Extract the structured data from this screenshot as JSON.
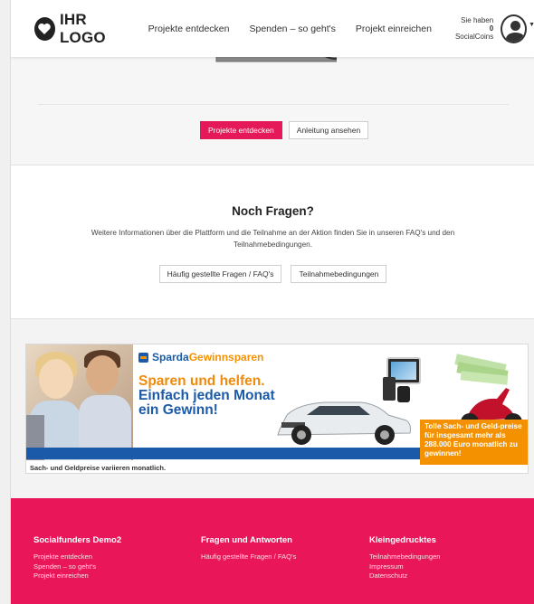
{
  "header": {
    "logo_text": "IHR LOGO",
    "nav": [
      "Projekte entdecken",
      "Spenden – so geht's",
      "Projekt einreichen"
    ],
    "coins_line1": "Sie haben",
    "coins_value": "0",
    "coins_line2": "SocialCoins"
  },
  "top": {
    "primary_button": "Projekte entdecken",
    "secondary_button": "Anleitung ansehen"
  },
  "faq": {
    "title": "Noch Fragen?",
    "text": "Weitere Informationen über die Plattform und die Teilnahme an der Aktion finden Sie in unseren FAQ's und den Teilnahmebedingungen.",
    "button_faq": "Häufig gestellte Fragen / FAQ's",
    "button_terms": "Teilnahmebedingungen"
  },
  "banner": {
    "brand_sparda": "Sparda",
    "brand_gewinnsparen": "Gewinnsparen",
    "headline_1": "Sparen und helfen.",
    "headline_2": "Einfach jeden Monat",
    "headline_3": "ein Gewinn!",
    "prize_text": "Tolle Sach- und Geld-preise für insgesamt mehr als 288.000 Euro monatlich zu gewinnen!",
    "footnote": "Sach- und Geldpreise variieren monatlich."
  },
  "footer": {
    "col1": {
      "title": "Socialfunders Demo2",
      "links": [
        "Projekte entdecken",
        "Spenden – so geht's",
        "Projekt einreichen"
      ]
    },
    "col2": {
      "title": "Fragen und Antworten",
      "links": [
        "Häufig gestellte Fragen / FAQ's"
      ]
    },
    "col3": {
      "title": "Kleingedrucktes",
      "links": [
        "Teilnahmebedingungen",
        "Impressum",
        "Datenschutz"
      ]
    }
  },
  "colors": {
    "accent": "#e5185a",
    "footer_bg": "#e9175a",
    "sparda_blue": "#1a5aa8",
    "sparda_orange": "#f49100"
  },
  "icons": [
    "heart-logo-icon",
    "user-avatar-icon",
    "caret-down-icon"
  ]
}
